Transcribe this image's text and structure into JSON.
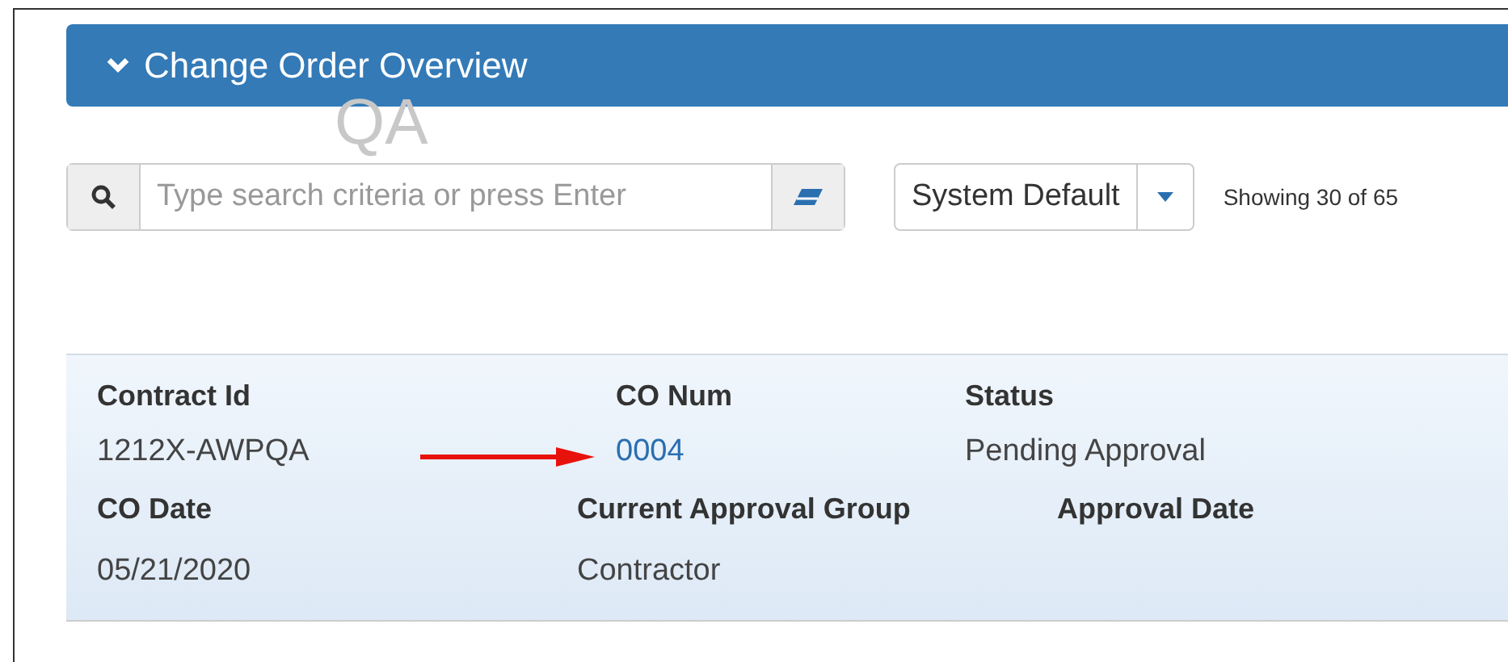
{
  "panel": {
    "title": "Change Order Overview",
    "expanded": true
  },
  "environment_label": "QA",
  "search": {
    "placeholder": "Type search criteria or press Enter"
  },
  "view_select": {
    "value": "System Default"
  },
  "record_count": "Showing 30 of 65",
  "record": {
    "rows": [
      {
        "fields": [
          {
            "label": "Contract Id",
            "value": "1212X-AWPQA",
            "kind": "text"
          },
          {
            "label": "CO Num",
            "value": "0004",
            "kind": "link"
          },
          {
            "label": "Status",
            "value": "Pending Approval",
            "kind": "text"
          }
        ]
      },
      {
        "fields": [
          {
            "label": "CO Date",
            "value": "05/21/2020",
            "kind": "text"
          },
          {
            "label": "Current Approval Group",
            "value": "Contractor",
            "kind": "text"
          },
          {
            "label": "Approval Date"
          }
        ]
      }
    ]
  }
}
